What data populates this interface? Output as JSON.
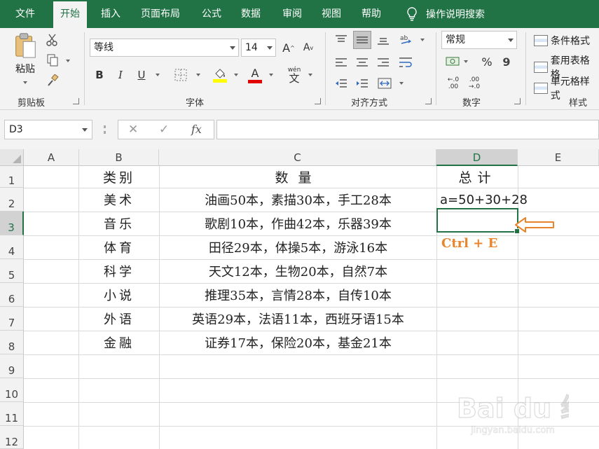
{
  "menu": {
    "items": [
      "文件",
      "开始",
      "插入",
      "页面布局",
      "公式",
      "数据",
      "审阅",
      "视图",
      "帮助"
    ],
    "active": "开始",
    "tell_me": "操作说明搜索"
  },
  "ribbon": {
    "clipboard": {
      "paste_label": "粘贴",
      "group_label": "剪贴板"
    },
    "font": {
      "font_name": "等线",
      "font_size": "14",
      "grow_glyph": "A",
      "shrink_glyph": "A",
      "bold": "B",
      "italic": "I",
      "underline": "U",
      "font_color_glyph": "A",
      "phonetic_glyph": "wén",
      "phonetic_char": "文",
      "group_label": "字体"
    },
    "alignment": {
      "group_label": "对齐方式"
    },
    "number": {
      "format": "常规",
      "percent": "%",
      "comma": "9",
      "group_label": "数字",
      "inc_decimal_top": "←.0",
      "inc_decimal_bottom": ".00",
      "dec_decimal_top": ".00",
      "dec_decimal_bottom": "→.0"
    },
    "styles": {
      "conditional_format": "条件格式",
      "format_as_table": "套用表格格",
      "cell_styles": "单元格样式",
      "group_label": "样式"
    }
  },
  "formula_bar": {
    "name_box": "D3",
    "fx": "fx",
    "formula": ""
  },
  "sheet": {
    "columns": [
      "A",
      "B",
      "C",
      "D",
      "E"
    ],
    "selected_column": "D",
    "rows": [
      "1",
      "2",
      "3",
      "4",
      "5",
      "6",
      "7",
      "8",
      "9",
      "10",
      "11",
      "12"
    ],
    "selected_row": "3",
    "headers": {
      "B1": "类别",
      "C1": "数量",
      "D1": "总计"
    },
    "data": [
      {
        "category": "美术",
        "quantity": "油画50本，素描30本，手工28本",
        "total": "a=50+30+28"
      },
      {
        "category": "音乐",
        "quantity": "歌剧10本，作曲42本，乐器39本",
        "total": ""
      },
      {
        "category": "体育",
        "quantity": "田径29本，体操5本，游泳16本",
        "total": ""
      },
      {
        "category": "科学",
        "quantity": "天文12本，生物20本，自然7本",
        "total": ""
      },
      {
        "category": "小说",
        "quantity": "推理35本，言情28本，自传10本",
        "total": ""
      },
      {
        "category": "外语",
        "quantity": "英语29本，法语11本，西班牙语15本",
        "total": ""
      },
      {
        "category": "金融",
        "quantity": "证券17本，保险20本，基金21本",
        "total": ""
      }
    ],
    "annotation": "Ctrl + E",
    "watermark": "Bai du 经验",
    "watermark_url": "jingyan.baidu.com"
  },
  "colors": {
    "excel_green": "#217346",
    "annotation_orange": "#e8852c"
  }
}
